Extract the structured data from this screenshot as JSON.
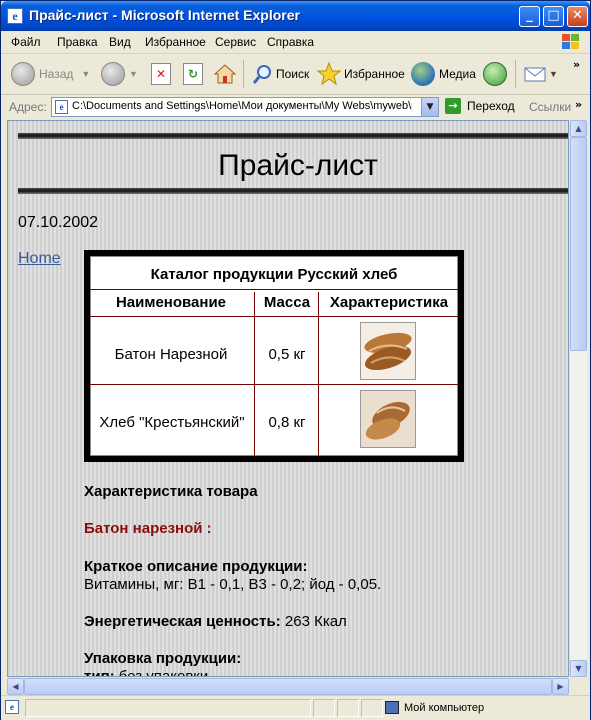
{
  "window": {
    "title": "Прайс-лист - Microsoft Internet Explorer"
  },
  "menu": [
    "Файл",
    "Правка",
    "Вид",
    "Избранное",
    "Сервис",
    "Справка"
  ],
  "toolbar": {
    "back": "Назад",
    "search": "Поиск",
    "favorites": "Избранное",
    "media": "Медиа"
  },
  "address": {
    "label": "Адрес:",
    "value": "C:\\Documents and Settings\\Home\\Мои документы\\My Webs\\myweb\\pri",
    "go": "Переход",
    "links": "Ссылки"
  },
  "page": {
    "title": "Прайс-лист",
    "date": "07.10.2002",
    "home_link": "Home",
    "catalog": {
      "caption": "Каталог продукции Русский  хлеб",
      "headers": [
        "Наименование",
        "Масса",
        "Характеристика"
      ],
      "rows": [
        {
          "name": "Батон Нарезной",
          "mass": "0,5 кг"
        },
        {
          "name": "Хлеб \"Крестьянский\"",
          "mass": "0,8 кг"
        }
      ]
    },
    "details": {
      "section_title": "Характеристика товара",
      "product_heading": "Батон нарезной :",
      "short_desc_label": "Краткое описание продукции:",
      "short_desc_text": "Витамины, мг: В1 - 0,1, В3 - 0,2; йод - 0,05.",
      "energy_label": "Энергетическая ценность:",
      "energy_value": "263 Ккал",
      "packaging_label": "Упаковка продукции:",
      "packaging_type_label": "тип:",
      "packaging_type_value": "без упаковки"
    }
  },
  "status": {
    "zone": "Мой компьютер"
  }
}
